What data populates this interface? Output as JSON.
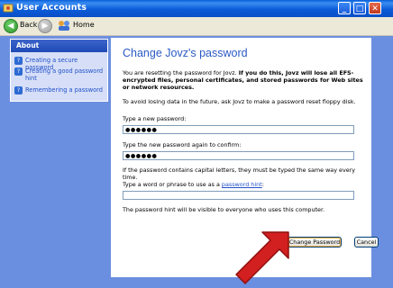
{
  "window": {
    "title": "User Accounts",
    "min_label": "_",
    "max_label": "□",
    "close_label": "✕"
  },
  "toolbar": {
    "back_label": "Back",
    "home_label": "Home"
  },
  "sidebar": {
    "heading": "About",
    "items": [
      {
        "label": "Creating a secure password"
      },
      {
        "label": "Creating a good password hint"
      },
      {
        "label": "Remembering a password"
      }
    ]
  },
  "main": {
    "title": "Change Jovz's password",
    "intro_plain": "You are resetting the password for Jovz. ",
    "intro_bold": "If you do this, Jovz will lose all EFS-encrypted files, personal certificates, and stored passwords for Web sites or network resources.",
    "avoid_text": "To avoid losing data in the future, ask Jovz to make a password reset floppy disk.",
    "new_pw_label": "Type a new password:",
    "new_pw_value": "●●●●●●",
    "confirm_label": "Type the new password again to confirm:",
    "confirm_value": "●●●●●●",
    "caps_note": "If the password contains capital letters, they must be typed the same way every time.",
    "hint_label_prefix": "Type a word or phrase to use as a ",
    "hint_link": "password hint",
    "hint_label_suffix": ":",
    "hint_value": "",
    "hint_note": "The password hint will be visible to everyone who uses this computer.",
    "change_button": "Change Password",
    "cancel_button": "Cancel"
  },
  "colors": {
    "accent": "#2a59c4",
    "arrow": "#d21f1f"
  }
}
